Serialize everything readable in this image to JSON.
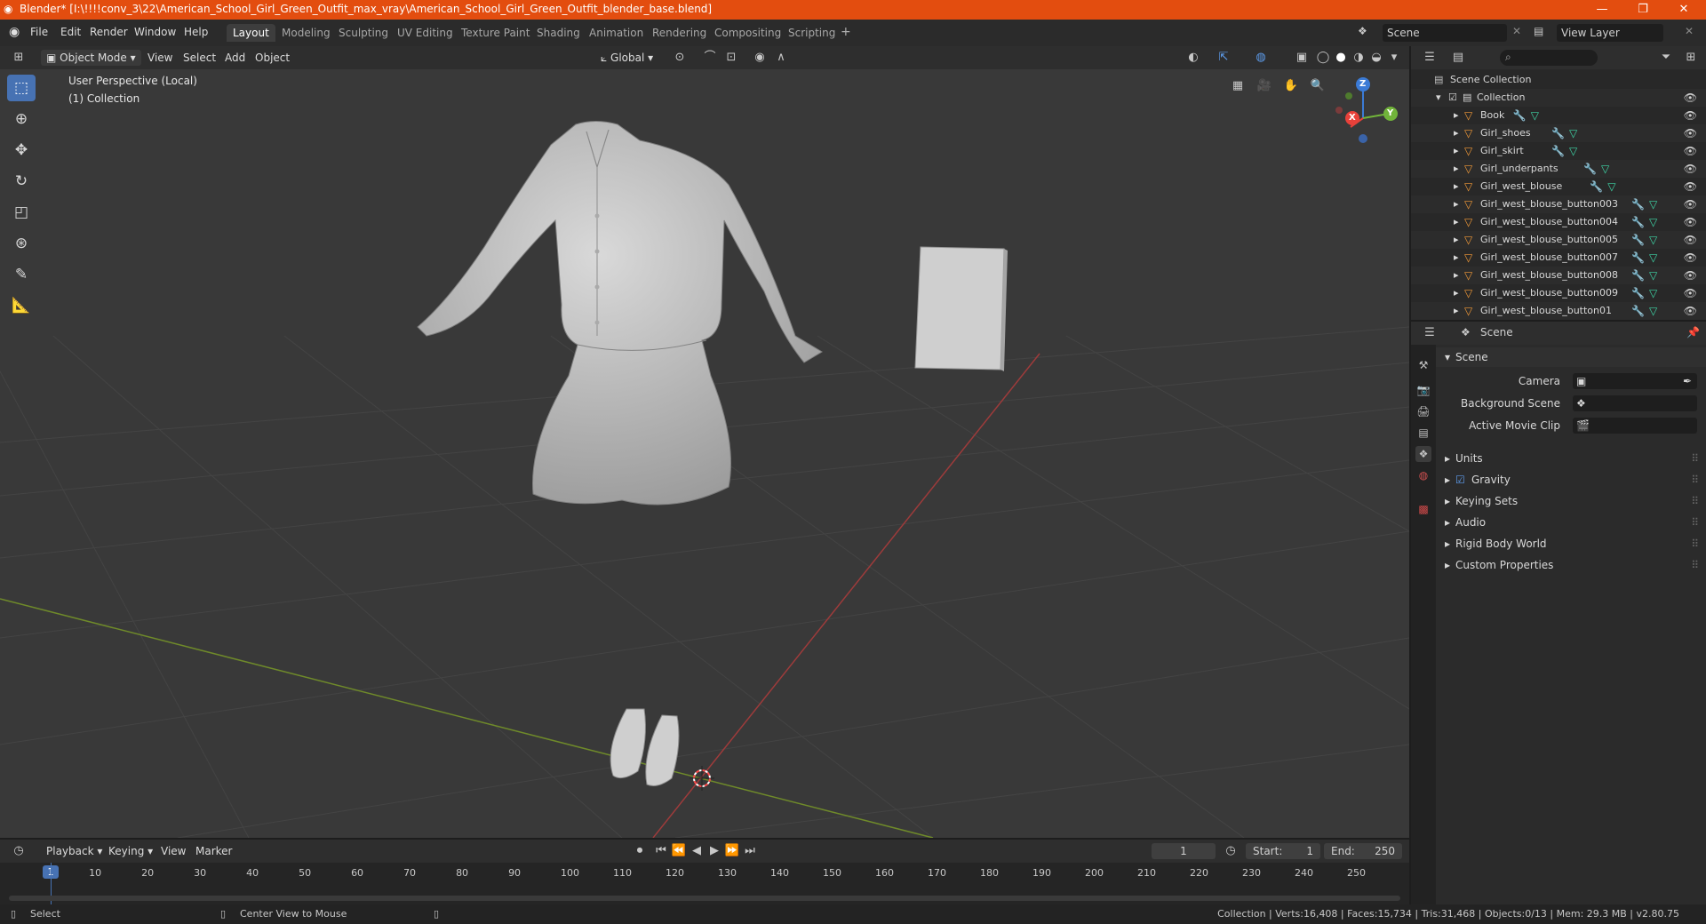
{
  "titlebar": {
    "title": "Blender* [I:\\!!!!conv_3\\22\\American_School_Girl_Green_Outfit_max_vray\\American_School_Girl_Green_Outfit_blender_base.blend]",
    "minimize": "—",
    "maximize": "❐",
    "close": "✕"
  },
  "menu": {
    "file": "File",
    "edit": "Edit",
    "render": "Render",
    "window": "Window",
    "help": "Help"
  },
  "workspaces": [
    "Layout",
    "Modeling",
    "Sculpting",
    "UV Editing",
    "Texture Paint",
    "Shading",
    "Animation",
    "Rendering",
    "Compositing",
    "Scripting"
  ],
  "scene_selector": {
    "scene": "Scene",
    "view_layer": "View Layer"
  },
  "viewport_header": {
    "mode": "Object Mode",
    "view": "View",
    "select": "Select",
    "add": "Add",
    "object": "Object",
    "transform": "Global"
  },
  "viewport": {
    "perspective": "User Perspective (Local)",
    "collection": "(1) Collection",
    "gizmo": {
      "x": "X",
      "y": "Y",
      "z": "Z"
    }
  },
  "outliner": {
    "scene_collection": "Scene Collection",
    "collection": "Collection",
    "items": [
      "Book",
      "Girl_shoes",
      "Girl_skirt",
      "Girl_underpants",
      "Girl_west_blouse",
      "Girl_west_blouse_button003",
      "Girl_west_blouse_button004",
      "Girl_west_blouse_button005",
      "Girl_west_blouse_button007",
      "Girl_west_blouse_button008",
      "Girl_west_blouse_button009",
      "Girl_west_blouse_button01"
    ]
  },
  "properties": {
    "header": "Scene",
    "section": "Scene",
    "camera_label": "Camera",
    "background_scene_label": "Background Scene",
    "active_movie_clip_label": "Active Movie Clip",
    "panels": [
      "Units",
      "Gravity",
      "Keying Sets",
      "Audio",
      "Rigid Body World",
      "Custom Properties"
    ]
  },
  "timeline": {
    "playback": "Playback",
    "keying": "Keying",
    "view": "View",
    "marker": "Marker",
    "current_frame": "1",
    "start_label": "Start:",
    "start": "1",
    "end_label": "End:",
    "end": "250",
    "ticks": [
      "1",
      "10",
      "20",
      "30",
      "40",
      "50",
      "60",
      "70",
      "80",
      "90",
      "100",
      "110",
      "120",
      "130",
      "140",
      "150",
      "160",
      "170",
      "180",
      "190",
      "200",
      "210",
      "220",
      "230",
      "240",
      "250"
    ]
  },
  "statusbar": {
    "select": "Select",
    "center_view": "Center View to Mouse",
    "stats": "Collection | Verts:16,408 | Faces:15,734 | Tris:31,468 | Objects:0/13 | Mem: 29.3 MB | v2.80.75"
  },
  "colors": {
    "title_bar": "#e34d0f",
    "active_tool": "#4772b3",
    "object_icon": "#f29a38",
    "mesh_icon": "#3fd6a7"
  }
}
